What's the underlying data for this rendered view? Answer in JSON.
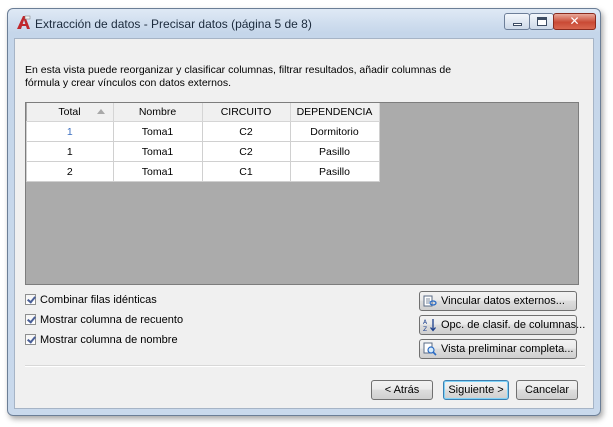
{
  "window": {
    "title": "Extracción de datos - Precisar datos (página 5 de 8)",
    "controls": {
      "minimize": "",
      "maximize": "",
      "close": "✕"
    }
  },
  "description": "En esta vista puede reorganizar y clasificar columnas, filtrar resultados, añadir columnas de fórmula y crear vínculos con datos externos.",
  "table": {
    "columns": [
      "Total",
      "Nombre",
      "CIRCUITO",
      "DEPENDENCIA"
    ],
    "sorted_column": "Total",
    "rows": [
      [
        "1",
        "Toma1",
        "C2",
        "Dormitorio"
      ],
      [
        "1",
        "Toma1",
        "C2",
        "Pasillo"
      ],
      [
        "2",
        "Toma1",
        "C1",
        "Pasillo"
      ]
    ]
  },
  "options": [
    {
      "label": "Combinar filas idénticas",
      "checked": true
    },
    {
      "label": "Mostrar columna de recuento",
      "checked": true
    },
    {
      "label": "Mostrar columna de nombre",
      "checked": true
    }
  ],
  "side_buttons": {
    "link_external": "Vincular datos externos...",
    "sort_columns": "Opc. de clasif. de columnas...",
    "full_preview": "Vista preliminar completa..."
  },
  "nav_buttons": {
    "back": "< Atrás",
    "next": "Siguiente >",
    "cancel": "Cancelar"
  },
  "colors": {
    "grid_background": "#ababab",
    "selected_cell_text": "#3c6fc0"
  }
}
